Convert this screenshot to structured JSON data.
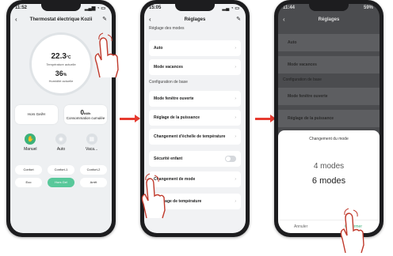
{
  "phone1": {
    "time": "11:52",
    "title": "Thermostat électrique Kozii",
    "temperature": "22.3",
    "temp_unit": "°C",
    "temp_label": "Température actuelle",
    "humidity": "36",
    "humidity_unit": "%",
    "humidity_label": "Humidité actuelle",
    "offline_label": "Hors Gel/H",
    "energy_value": "0",
    "energy_unit": "kWh",
    "energy_label": "Consommation cumulée",
    "modes": [
      {
        "label": "Manuel",
        "icon": "hand-icon"
      },
      {
        "label": "Auto",
        "icon": "auto-icon"
      },
      {
        "label": "Vaca...",
        "icon": "vacation-icon"
      }
    ],
    "presets": [
      "Confort",
      "Confort-1",
      "Confort-2",
      "Eco",
      "Hors Gel",
      "Arrêt"
    ],
    "accent": "#3cb27a"
  },
  "phone2": {
    "time": "15:05",
    "title": "Réglages",
    "section_modes": "Réglage des modes",
    "auto": "Auto",
    "vacation": "Mode vacances",
    "section_base": "Configuration de base",
    "window": "Mode fenêtre ouverte",
    "power": "Réglage de la puissance",
    "scale": "Changement d'échelle de température",
    "child": "Sécurité enfant",
    "mode_change": "Changement de mode",
    "calibration": "Calibrage de température"
  },
  "phone3": {
    "time": "11:44",
    "battery": "59%",
    "title": "Réglages",
    "auto": "Auto",
    "vacation": "Mode vacances",
    "section_base": "Configuration de base",
    "window": "Mode fenêtre ouverte",
    "power": "Réglage de la puissance",
    "sheet_title": "Changement du mode",
    "option1": "4 modes",
    "option2": "6 modes",
    "cancel": "Annuler",
    "confirm": "Confirmer",
    "confirm_color": "#3cb27a"
  },
  "arrow_color": "#e63a2f"
}
